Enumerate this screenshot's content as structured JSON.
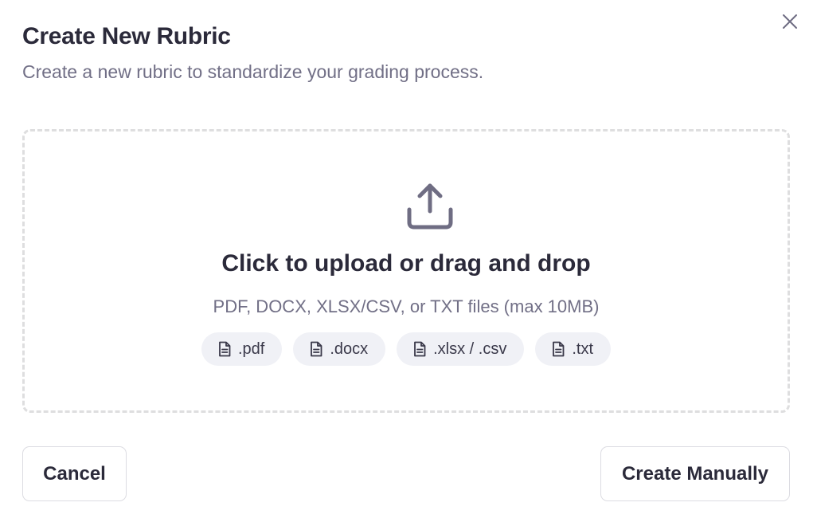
{
  "dialog": {
    "title": "Create New Rubric",
    "subtitle": "Create a new rubric to standardize your grading process.",
    "close_icon": "close-icon"
  },
  "upload": {
    "icon": "upload-icon",
    "title": "Click to upload or drag and drop",
    "hint": "PDF, DOCX, XLSX/CSV, or TXT files (max 10MB)",
    "file_types": [
      {
        "label": ".pdf",
        "icon": "file-icon"
      },
      {
        "label": ".docx",
        "icon": "file-icon"
      },
      {
        "label": ".xlsx / .csv",
        "icon": "file-icon"
      },
      {
        "label": ".txt",
        "icon": "file-icon"
      }
    ]
  },
  "actions": {
    "cancel_label": "Cancel",
    "create_manually_label": "Create Manually"
  },
  "colors": {
    "text_primary": "#2b2a3a",
    "text_muted": "#716f86",
    "icon": "#6f6d83",
    "chip_bg": "#f0f1f6",
    "dashed_border": "#dededf"
  }
}
